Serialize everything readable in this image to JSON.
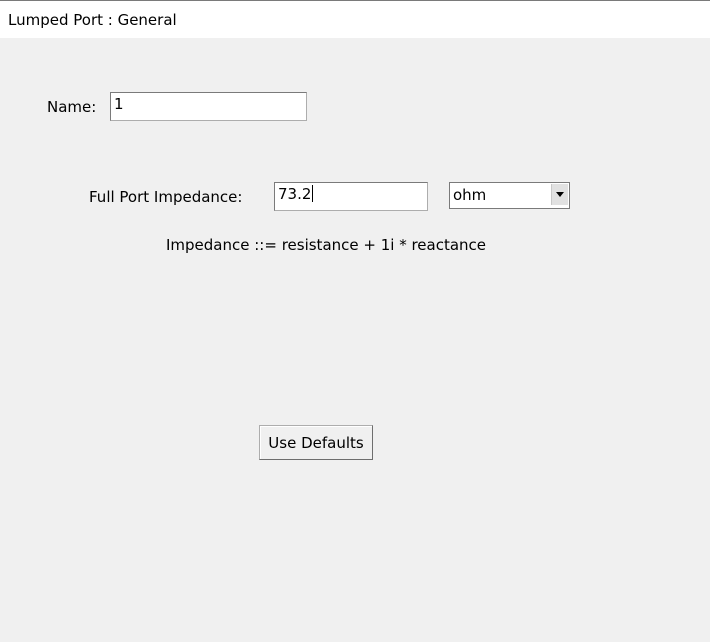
{
  "header": {
    "title": "Lumped Port : General"
  },
  "form": {
    "name_label": "Name:",
    "name_value": "1",
    "impedance_label": "Full Port Impedance:",
    "impedance_value": "73.2",
    "impedance_unit": "ohm",
    "impedance_hint": "Impedance ::= resistance + 1i * reactance",
    "defaults_button_label": "Use Defaults"
  },
  "icons": {
    "unit_dropdown_arrow": "chevron-down-icon"
  }
}
